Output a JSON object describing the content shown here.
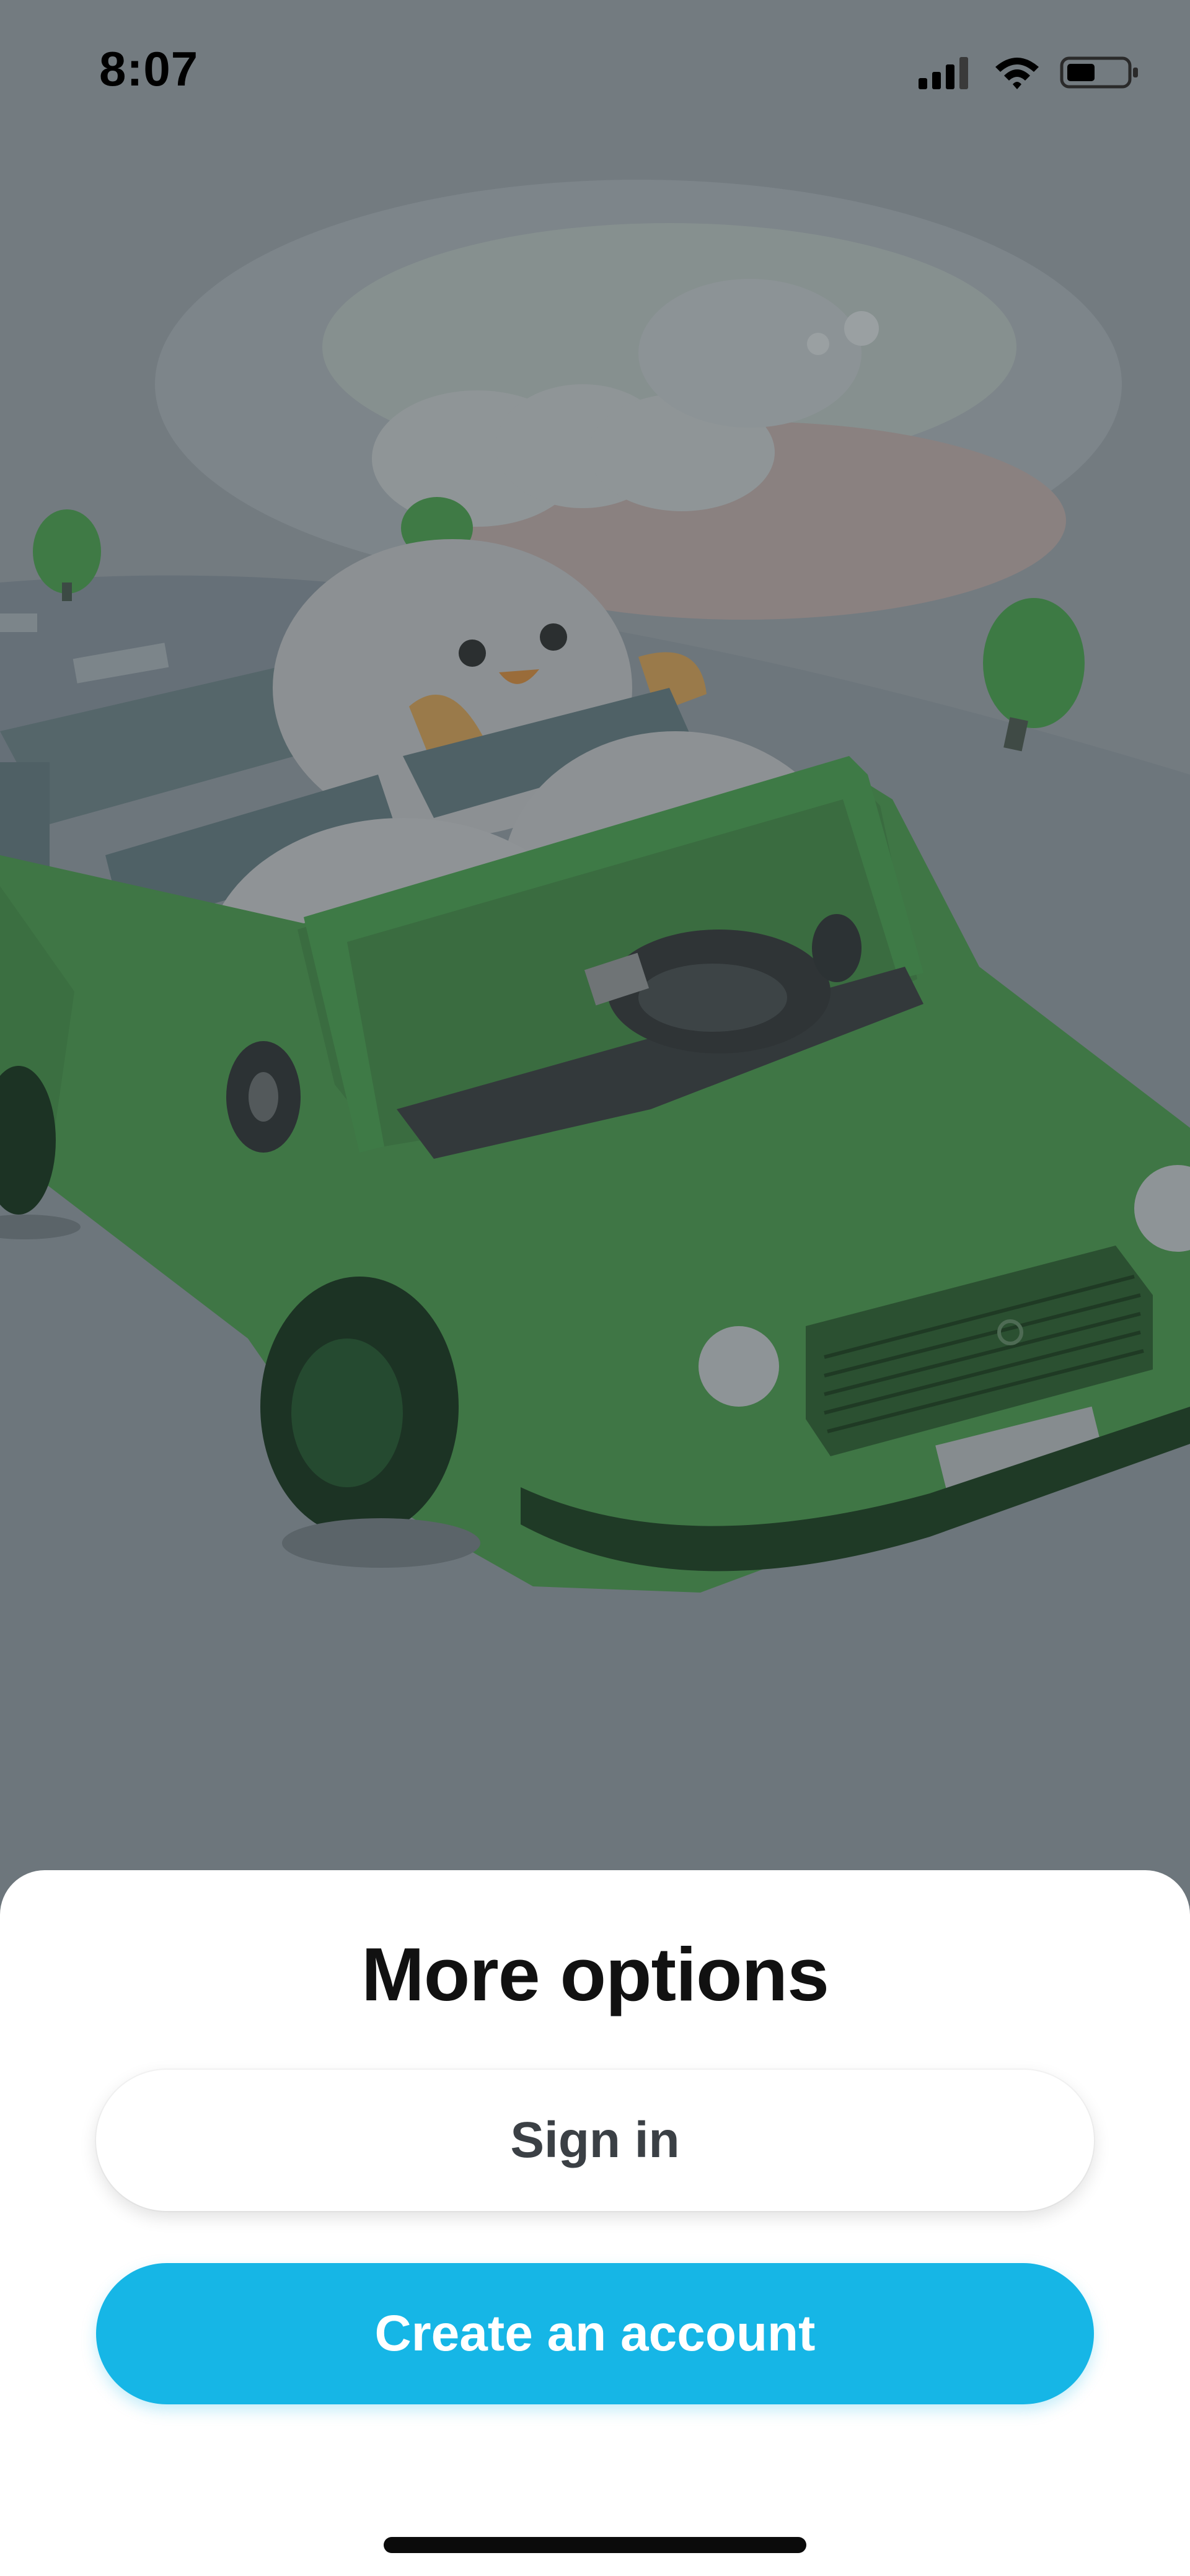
{
  "status_bar": {
    "time": "8:07",
    "icons": [
      "signal-icon",
      "wifi-icon",
      "battery-icon"
    ]
  },
  "illustration": {
    "subject": "car-illustration"
  },
  "sheet": {
    "title": "More options",
    "sign_in_label": "Sign in",
    "create_account_label": "Create an account"
  },
  "colors": {
    "overlay": "#6b747a",
    "accent": "#16b6e6",
    "sheet_bg": "#ffffff",
    "title_text": "#111111",
    "secondary_button_text": "#3b4045"
  }
}
